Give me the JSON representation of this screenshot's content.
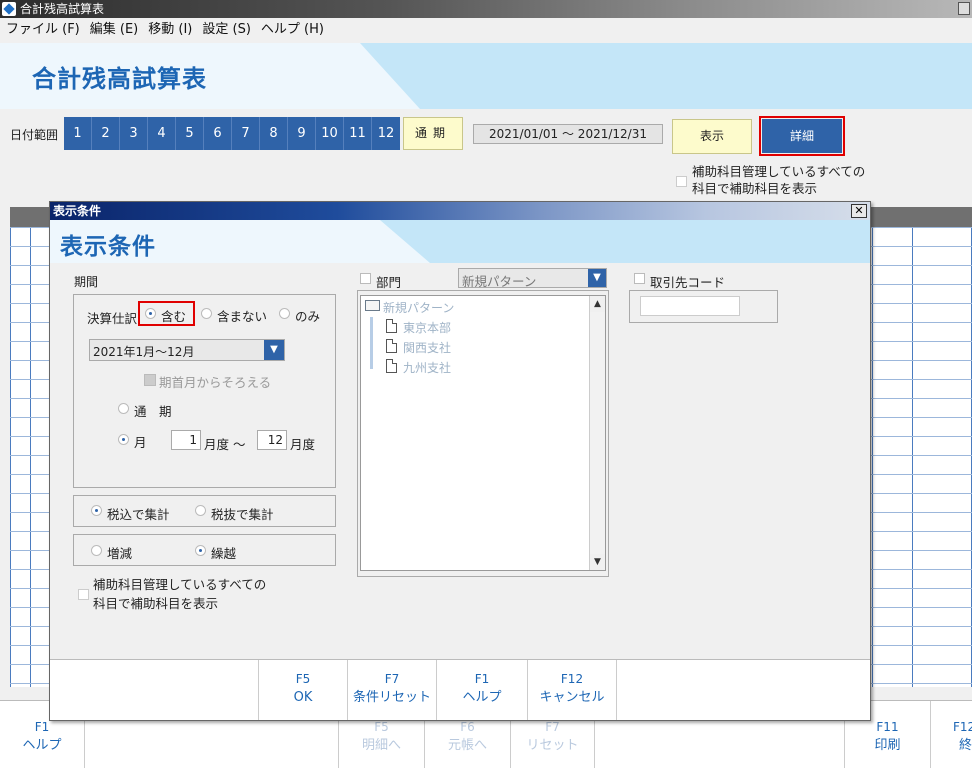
{
  "window": {
    "title": "合計残高試算表"
  },
  "menu": [
    "ファイル (F)",
    "編集 (E)",
    "移動 (I)",
    "設定 (S)",
    "ヘルプ (H)"
  ],
  "page_title": "合計残高試算表",
  "date_filter": {
    "label": "日付範囲",
    "months": [
      "1",
      "2",
      "3",
      "4",
      "5",
      "6",
      "7",
      "8",
      "9",
      "10",
      "11",
      "12"
    ],
    "full_period_label": "通期",
    "range_text": "2021/01/01 ～ 2021/12/31"
  },
  "toolbar": {
    "show_label": "表示",
    "detail_label": "詳細"
  },
  "main_sub_option": {
    "line1": "補助科目管理しているすべての",
    "line2": "科目で補助科目を表示"
  },
  "main_fkeys": [
    {
      "key": "F1",
      "label": "ヘルプ",
      "enabled": true
    },
    {
      "key": "F5",
      "label": "明細へ",
      "enabled": false
    },
    {
      "key": "F6",
      "label": "元帳へ",
      "enabled": false
    },
    {
      "key": "F7",
      "label": "リセット",
      "enabled": false
    },
    {
      "key": "F11",
      "label": "印刷",
      "enabled": true
    },
    {
      "key": "F12",
      "label": "終",
      "enabled": true
    }
  ],
  "dialog": {
    "title": "表示条件",
    "header": "表示条件",
    "close_glyph": "✕",
    "period": {
      "label": "期間",
      "settlement_label": "決算仕訳",
      "settlement_options": [
        "含む",
        "含まない",
        "のみ"
      ],
      "settlement_selected": "含む",
      "period_select_value": "2021年1月～12月",
      "align_check_label": "期首月からそろえる",
      "full_period_label": "通　期",
      "month_label": "月",
      "month_from": "1",
      "month_from_suffix": "月度 ～",
      "month_to": "12",
      "month_to_suffix": "月度",
      "mode_selected": "月"
    },
    "tax": {
      "options": [
        "税込で集計",
        "税抜で集計"
      ],
      "selected": "税込で集計"
    },
    "amount": {
      "options": [
        "増減",
        "繰越"
      ],
      "selected": "繰越"
    },
    "sub_option": {
      "line1": "補助科目管理しているすべての",
      "line2": "科目で補助科目を表示"
    },
    "dept": {
      "label": "部門",
      "pattern_value": "新規パターン",
      "tree_root": "新規パターン",
      "tree_children": [
        "東京本部",
        "関西支社",
        "九州支社"
      ]
    },
    "client": {
      "label": "取引先コード",
      "value": ""
    },
    "fkeys": [
      {
        "key": "F5",
        "label": "OK"
      },
      {
        "key": "F7",
        "label": "条件リセット"
      },
      {
        "key": "F1",
        "label": "ヘルプ"
      },
      {
        "key": "F12",
        "label": "キャンセル"
      }
    ]
  },
  "colors": {
    "accent": "#2f63a8",
    "title_blue": "#1d66b4",
    "highlight_red": "#e00000",
    "yellow_button": "#fdfbcc",
    "banner": "#c4e6f8"
  }
}
